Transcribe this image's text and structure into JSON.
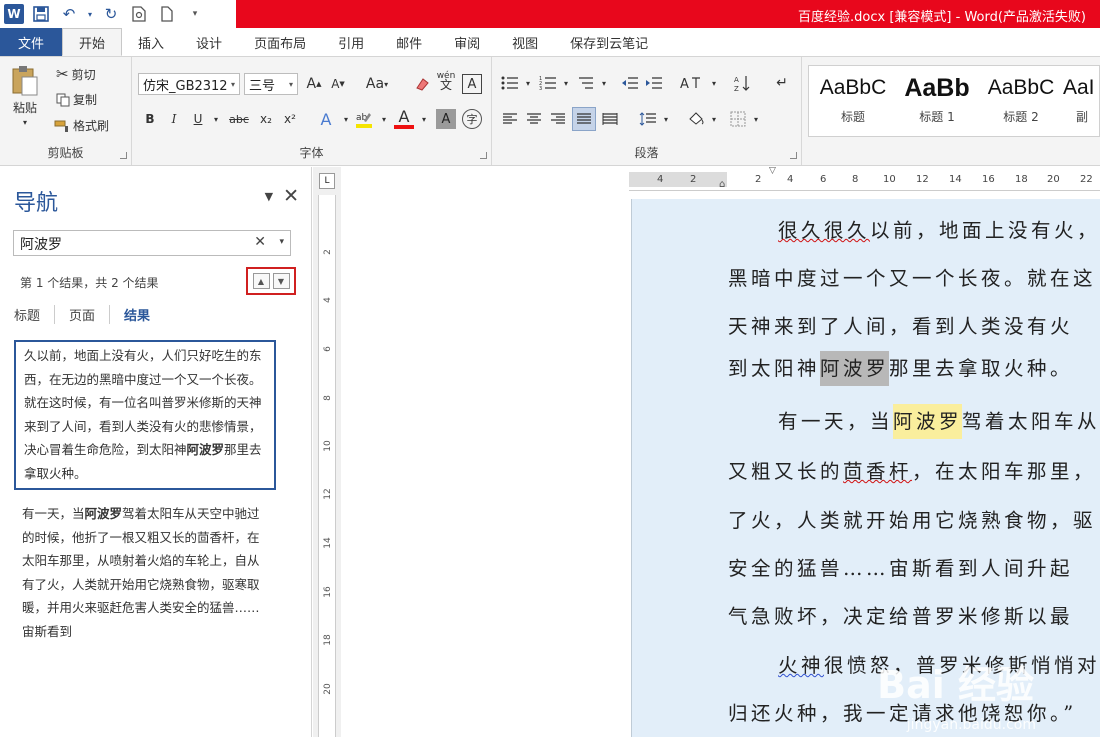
{
  "titlebar": {
    "title": "百度经验.docx [兼容模式] - Word(产品激活失败)",
    "word_logo": "W",
    "quick_access": [
      "save-icon",
      "undo-icon",
      "redo-icon",
      "print-preview-icon",
      "new-doc-icon",
      "customize-icon"
    ]
  },
  "menu": {
    "tabs": [
      "文件",
      "开始",
      "插入",
      "设计",
      "页面布局",
      "引用",
      "邮件",
      "审阅",
      "视图",
      "保存到云笔记"
    ],
    "active": "开始"
  },
  "ribbon": {
    "clipboard": {
      "paste": "粘贴",
      "cut": "剪切",
      "copy": "复制",
      "format_painter": "格式刷",
      "label": "剪贴板"
    },
    "font": {
      "font_name": "仿宋_GB2312",
      "font_size": "三号",
      "grow": "A",
      "shrink": "A",
      "change_case": "Aa",
      "wen": "wén",
      "A_box": "A",
      "bold": "B",
      "italic": "I",
      "underline": "U",
      "strikethrough": "abc",
      "subscript": "x₂",
      "superscript": "x²",
      "effects": "A",
      "font_color": "A",
      "shading": "A",
      "enclose": "字",
      "label": "字体"
    },
    "paragraph": {
      "label": "段落"
    },
    "styles": [
      {
        "sample": "AaBbC",
        "name": "标题"
      },
      {
        "sample": "AaBb",
        "name": "标题 1"
      },
      {
        "sample": "AaBbC",
        "name": "标题 2"
      },
      {
        "sample": "AaI",
        "name": "副"
      }
    ]
  },
  "nav": {
    "title": "导航",
    "search_value": "阿波罗",
    "result_count": "第 1 个结果，共 2 个结果",
    "subtabs": [
      "标题",
      "页面",
      "结果"
    ],
    "results": [
      {
        "before": "久以前，地面上没有火，人们只好吃生的东西，在无边的黑暗中度过一个又一个长夜。就在这时候，有一位名叫普罗米修斯的天神来到了人间，看到人类没有火的悲惨情景，决心冒着生命危险，到太阳神",
        "match": "阿波罗",
        "after": "那里去拿取火种。"
      },
      {
        "before": "有一天，当",
        "match": "阿波罗",
        "after": "驾着太阳车从天空中驰过的时候，他折了一根又粗又长的茴香杆，在太阳车那里，从喷射着火焰的车轮上，自从有了火，人类就开始用它烧熟食物，驱寒取暖，并用火来驱赶危害人类安全的猛兽……宙斯看到"
      }
    ]
  },
  "rulers": {
    "vertical_ticks": [
      "2",
      "4",
      "6",
      "8",
      "10",
      "12",
      "14",
      "16",
      "18",
      "20"
    ],
    "horizontal_ticks": [
      "4",
      "2",
      "2",
      "4",
      "6",
      "8",
      "10",
      "12",
      "14",
      "16",
      "18",
      "20",
      "22"
    ],
    "corner": "L"
  },
  "document": {
    "lines": [
      {
        "parts": [
          "很久很久",
          "以前，地面上没有火，"
        ]
      },
      {
        "parts": [
          "黑暗中度过一个又一个长夜。就在这"
        ]
      },
      {
        "parts": [
          "天神来到了人间，看到人类没有火"
        ]
      },
      {
        "parts": [
          "到太阳神",
          "阿波罗",
          "那里去拿取火种。"
        ]
      },
      {
        "parts": [
          "有一天，当",
          "阿波罗",
          "驾着太阳车从"
        ]
      },
      {
        "parts": [
          "又粗又长的",
          "茴香杆",
          "，在太阳车那里，"
        ]
      },
      {
        "parts": [
          "了火，人类就开始用它烧熟食物，驱"
        ]
      },
      {
        "parts": [
          "安全的猛兽……宙斯看到人间升起"
        ]
      },
      {
        "parts": [
          "气急败坏，决定给普罗米修斯以最"
        ]
      },
      {
        "parts": [
          "火神",
          "很愤怒，普罗米修斯悄悄对"
        ]
      },
      {
        "parts": [
          "归还火种，我一定请求他饶恕你。”"
        ]
      }
    ],
    "watermark": "Bai 经验",
    "watermark_url": "jingyan.baidu.com"
  }
}
